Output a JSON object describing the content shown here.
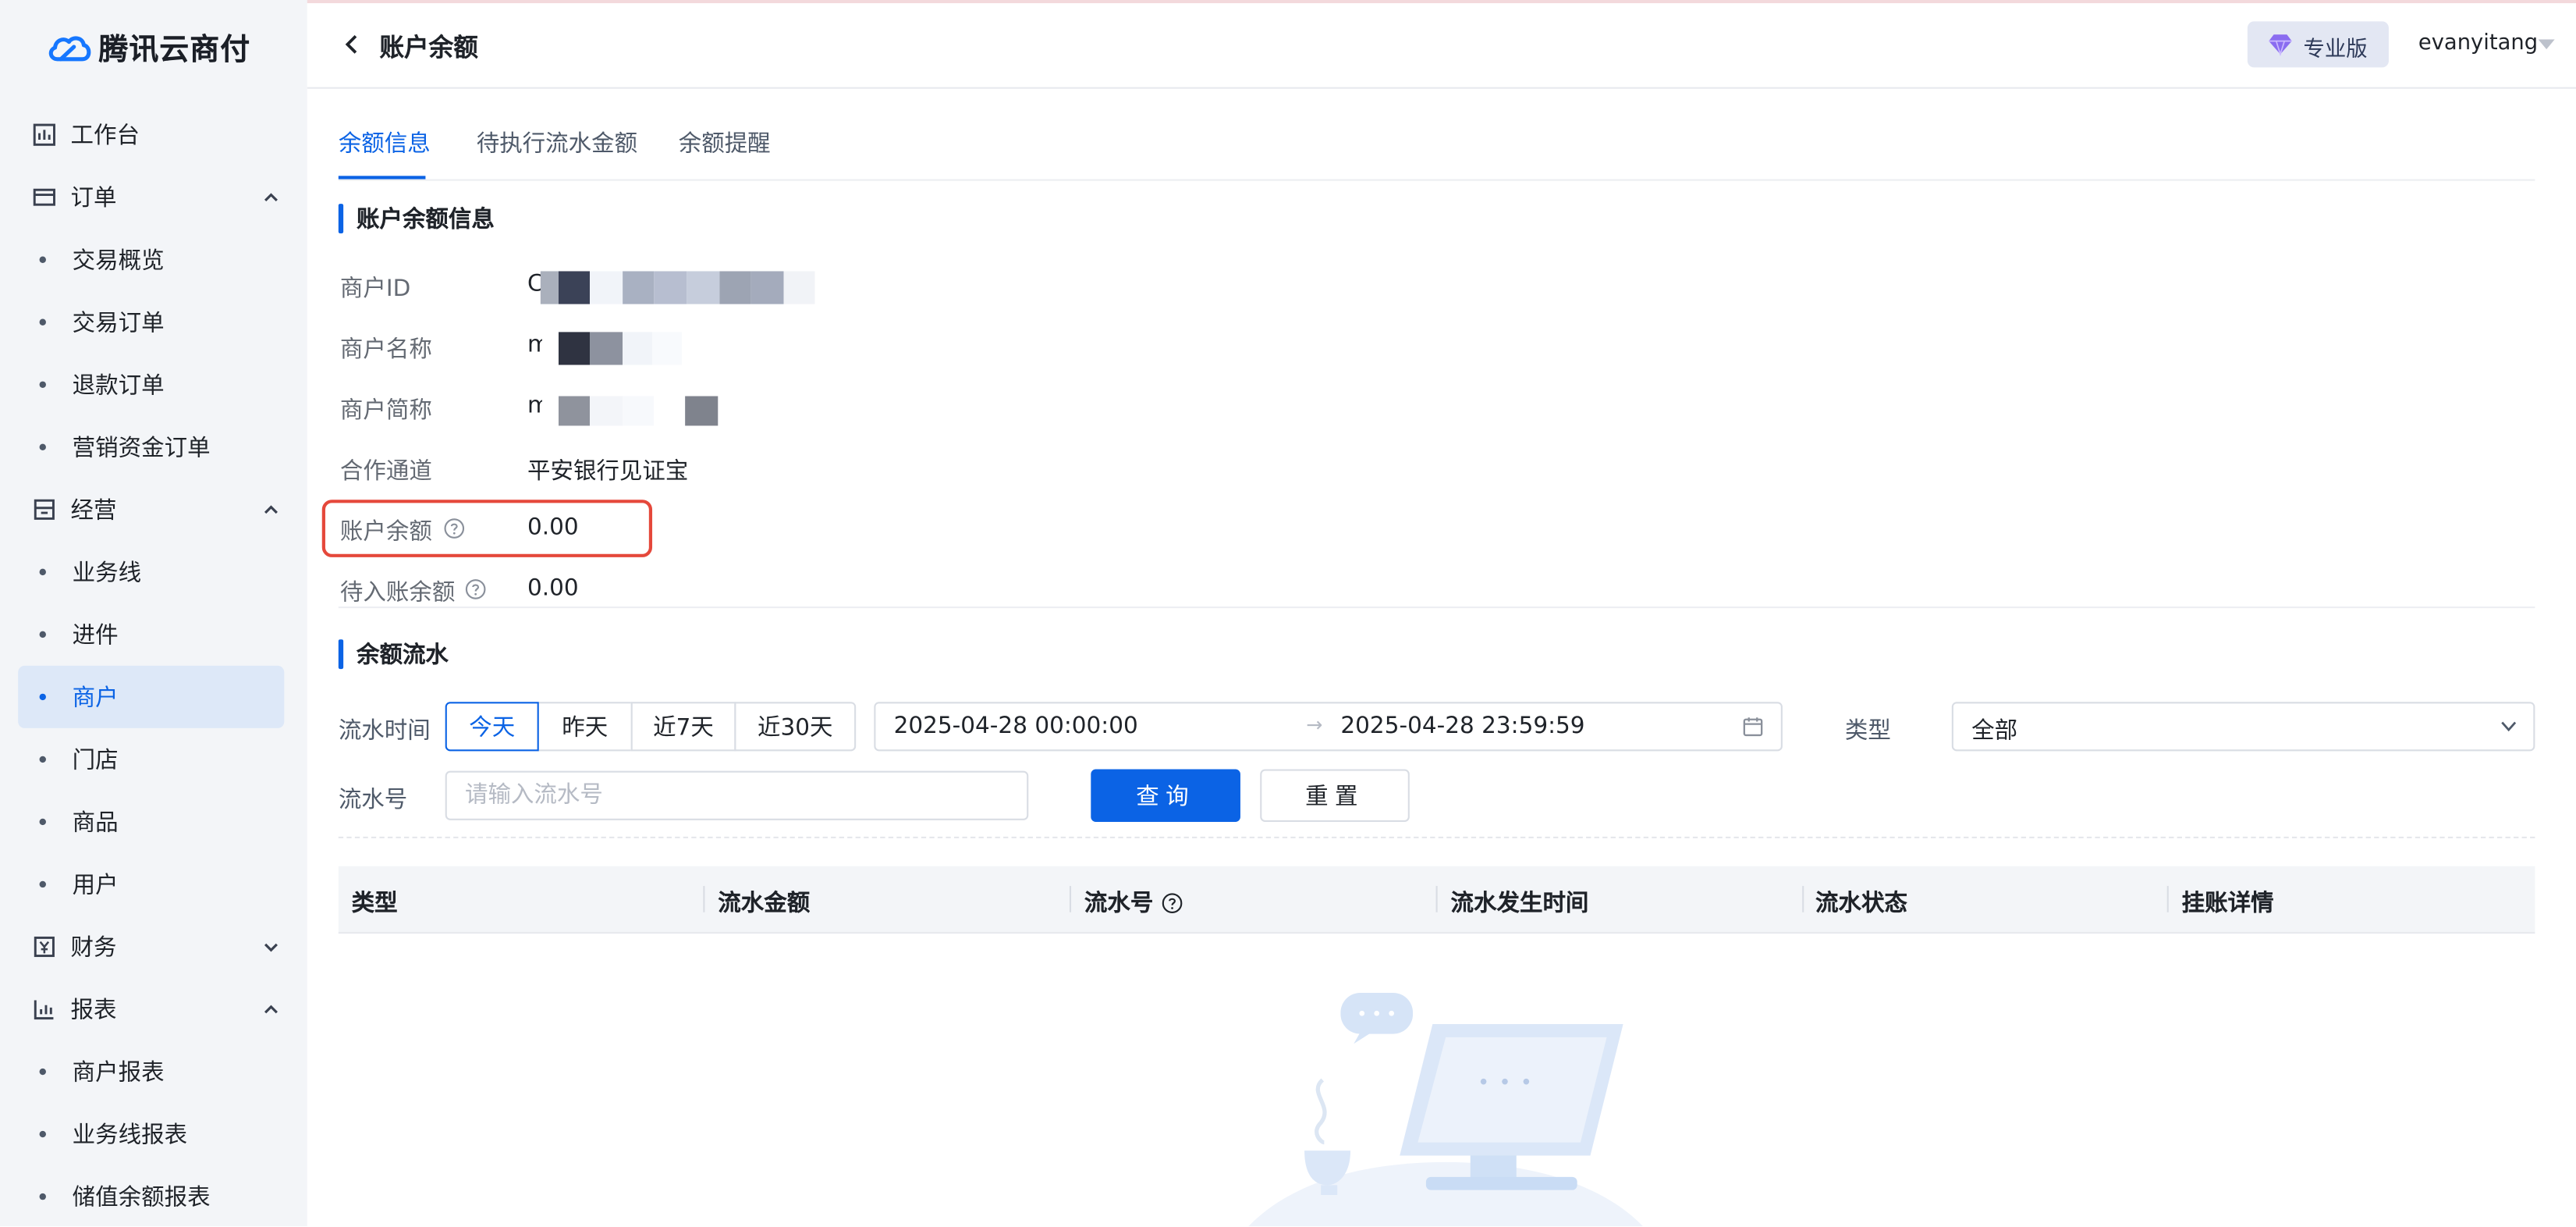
{
  "app": {
    "name": "腾讯云商付"
  },
  "sidebar": {
    "workbench": "工作台",
    "order": {
      "label": "订单",
      "items": [
        "交易概览",
        "交易订单",
        "退款订单",
        "营销资金订单"
      ]
    },
    "operation": {
      "label": "经营",
      "items": [
        "业务线",
        "进件",
        "商户",
        "门店",
        "商品",
        "用户"
      ],
      "active": "商户"
    },
    "finance": {
      "label": "财务"
    },
    "report": {
      "label": "报表",
      "items": [
        "商户报表",
        "业务线报表",
        "储值余额报表"
      ]
    }
  },
  "header": {
    "title": "账户余额",
    "edition": "专业版",
    "username": "evanyitang"
  },
  "tabs": [
    "余额信息",
    "待执行流水金额",
    "余额提醒"
  ],
  "active_tab": "余额信息",
  "balance_info": {
    "section_title": "账户余额信息",
    "merchant_id_label": "商户ID",
    "merchant_id_value": "C",
    "merchant_name_label": "商户名称",
    "merchant_name_value": "m",
    "merchant_short_label": "商户简称",
    "merchant_short_value": "m",
    "channel_label": "合作通道",
    "channel_value": "平安银行见证宝",
    "balance_label": "账户余额",
    "balance_value": "0.00",
    "pending_label": "待入账余额",
    "pending_value": "0.00"
  },
  "flow": {
    "section_title": "余额流水",
    "time_label": "流水时间",
    "quick_ranges": [
      "今天",
      "昨天",
      "近7天",
      "近30天"
    ],
    "selected_range": "今天",
    "start_time": "2025-04-28 00:00:00",
    "end_time": "2025-04-28 23:59:59",
    "range_arrow": "→",
    "type_label": "类型",
    "type_value": "全部",
    "flow_no_label": "流水号",
    "flow_no_placeholder": "请输入流水号",
    "search_button": "查询",
    "reset_button": "重置"
  },
  "table": {
    "columns": [
      "类型",
      "流水金额",
      "流水号",
      "流水发生时间",
      "流水状态",
      "挂账详情"
    ],
    "rows": []
  },
  "colors": {
    "primary": "#0b63e5",
    "highlight_border": "#e5483b",
    "sidebar_bg": "#f3f5f8"
  }
}
